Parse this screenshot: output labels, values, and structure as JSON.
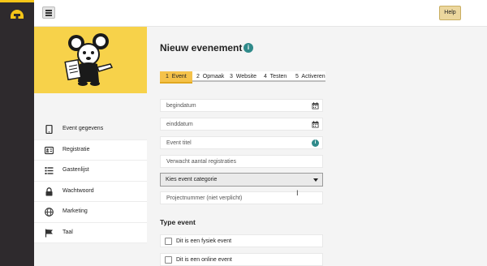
{
  "topbar": {
    "help_label": "Help"
  },
  "sidebar": {
    "items": [
      {
        "label": "Event gegevens",
        "icon": "tablet-icon",
        "active": true
      },
      {
        "label": "Registratie",
        "icon": "id-card-icon"
      },
      {
        "label": "Gastenlijst",
        "icon": "list-icon"
      },
      {
        "label": "Wachtwoord",
        "icon": "lock-icon"
      },
      {
        "label": "Marketing",
        "icon": "globe-icon"
      },
      {
        "label": "Taal",
        "icon": "flag-icon"
      }
    ]
  },
  "main": {
    "title": "Nieuw evenement",
    "steps": [
      {
        "num": "1",
        "label": "Event"
      },
      {
        "num": "2",
        "label": "Opmaak"
      },
      {
        "num": "3",
        "label": "Website"
      },
      {
        "num": "4",
        "label": "Testen"
      },
      {
        "num": "5",
        "label": "Activeren"
      }
    ],
    "fields": {
      "begindatum": "begindatum",
      "einddatum": "einddatum",
      "titel": "Event titel",
      "aantal": "Verwacht aantal registraties",
      "categorie": "Kies event categorie",
      "projectnummer": "Projectnummer (niet verplicht)"
    },
    "type_title": "Type event",
    "type_options": [
      "Dit is een fysiek event",
      "Dit is een online event"
    ]
  },
  "colors": {
    "accent": "#f5c24a",
    "info": "#2f8a8a",
    "dark": "#2e2a2d"
  }
}
